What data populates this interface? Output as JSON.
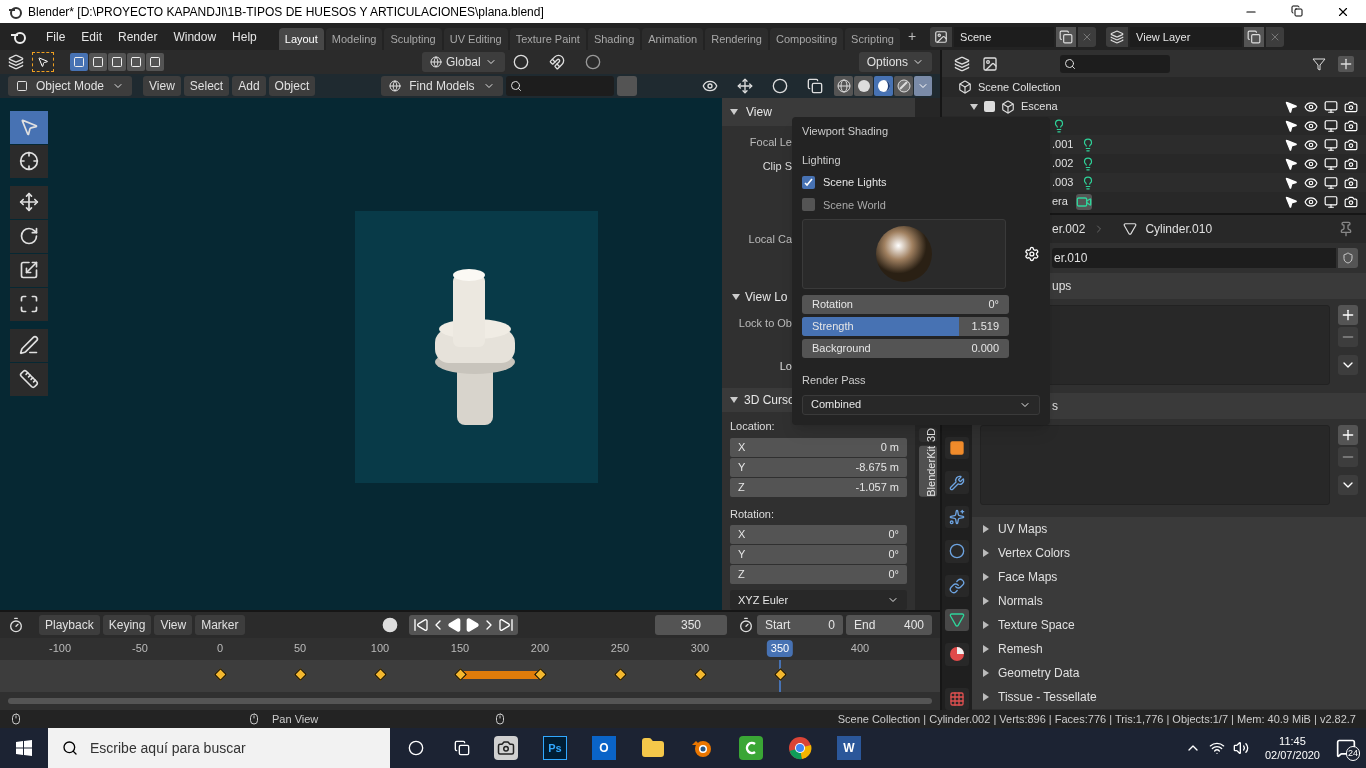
{
  "window": {
    "title": "Blender* [D:\\PROYECTO KAPANDJI\\1B-TIPOS DE HUESOS Y ARTICULACIONES\\plana.blend]"
  },
  "menu": [
    "File",
    "Edit",
    "Render",
    "Window",
    "Help"
  ],
  "workspaces": [
    {
      "label": "Layout",
      "selected": true
    },
    {
      "label": "Modeling",
      "selected": false
    },
    {
      "label": "Sculpting",
      "selected": false
    },
    {
      "label": "UV Editing",
      "selected": false
    },
    {
      "label": "Texture Paint",
      "selected": false
    },
    {
      "label": "Shading",
      "selected": false
    },
    {
      "label": "Animation",
      "selected": false
    },
    {
      "label": "Rendering",
      "selected": false
    },
    {
      "label": "Compositing",
      "selected": false
    },
    {
      "label": "Scripting",
      "selected": false
    }
  ],
  "add_workspace": "+",
  "scene_selector": {
    "value": "Scene"
  },
  "view_layer_selector": {
    "value": "View Layer"
  },
  "viewport": {
    "select_modes": [
      {
        "selected": true
      },
      {
        "selected": false
      },
      {
        "selected": false
      },
      {
        "selected": false
      },
      {
        "selected": false
      }
    ],
    "orientation": "Global",
    "options": "Options",
    "mode": "Object Mode",
    "menus": [
      "View",
      "Select",
      "Add",
      "Object"
    ],
    "find_models": "Find Models",
    "shading_modes": [
      {
        "kind": "wireframe",
        "selected": false
      },
      {
        "kind": "solid",
        "selected": false
      },
      {
        "kind": "material",
        "selected": true
      },
      {
        "kind": "rendered",
        "selected": false
      }
    ],
    "tools": [
      {
        "kind": "select-box",
        "selected": true
      },
      {
        "kind": "cursor",
        "selected": false
      },
      {
        "kind": "move",
        "selected": false
      },
      {
        "kind": "rotate",
        "selected": false
      },
      {
        "kind": "scale",
        "selected": false
      },
      {
        "kind": "transform",
        "selected": false
      },
      {
        "kind": "annotate",
        "selected": false
      },
      {
        "kind": "measure",
        "selected": false
      }
    ]
  },
  "sidebar": {
    "view_panel": {
      "title": "View",
      "expanded": true,
      "labels": [
        "Focal Le",
        "Clip S",
        "Local Ca"
      ]
    },
    "view_lock_panel": {
      "title": "View Lo",
      "expanded": true,
      "labels": [
        "Lock to Ob",
        "Lo"
      ]
    },
    "cursor_panel": {
      "title": "3D Curso",
      "expanded": true,
      "location_label": "Location:",
      "location": [
        {
          "axis": "X",
          "value": "0 m"
        },
        {
          "axis": "Y",
          "value": "-8.675 m"
        },
        {
          "axis": "Z",
          "value": "-1.057 m"
        }
      ],
      "rotation_label": "Rotation:",
      "rotation": [
        {
          "axis": "X",
          "value": "0°"
        },
        {
          "axis": "Y",
          "value": "0°"
        },
        {
          "axis": "Z",
          "value": "0°"
        }
      ],
      "rotation_mode": "XYZ Euler"
    },
    "tabs": [
      {
        "label": "3D",
        "selected": false
      },
      {
        "label": "BlenderKit",
        "selected": true
      }
    ]
  },
  "shading_popover": {
    "title": "Viewport Shading",
    "lighting_label": "Lighting",
    "options": [
      {
        "label": "Scene Lights",
        "checked": true
      },
      {
        "label": "Scene World",
        "checked": false
      }
    ],
    "sliders": [
      {
        "label": "Rotation",
        "value": "0°",
        "level": 0
      },
      {
        "label": "Strength",
        "value": "1.519",
        "level": 0.76
      },
      {
        "label": "Background",
        "value": "0.000",
        "level": 0
      }
    ],
    "render_pass_label": "Render Pass",
    "render_pass": "Combined"
  },
  "outliner": {
    "root": "Scene Collection",
    "collections": [
      {
        "name": "Escena",
        "checked": true,
        "expanded": true,
        "children": [
          {
            "kind": "light"
          },
          {
            "name": ".001",
            "kind": "light"
          },
          {
            "name": ".002",
            "kind": "light"
          },
          {
            "name": ".003",
            "kind": "light"
          },
          {
            "name": "era",
            "kind": "camera"
          }
        ]
      }
    ]
  },
  "properties": {
    "tabs": [
      {
        "kind": "object",
        "selected": false
      },
      {
        "kind": "modifiers",
        "selected": false
      },
      {
        "kind": "particles",
        "selected": false
      },
      {
        "kind": "physics",
        "selected": false
      },
      {
        "kind": "constraints",
        "selected": false
      },
      {
        "kind": "data",
        "selected": true
      },
      {
        "kind": "material",
        "selected": false
      },
      {
        "kind": "texture",
        "selected": false
      }
    ],
    "breadcrumb": [
      "er.002",
      "Cylinder.010"
    ],
    "mesh_name": "er.010",
    "list_panels": [
      {
        "title": "ups"
      },
      {
        "title": "s"
      }
    ],
    "panels": [
      {
        "title": "UV Maps",
        "expanded": false
      },
      {
        "title": "Vertex Colors",
        "expanded": false
      },
      {
        "title": "Face Maps",
        "expanded": false
      },
      {
        "title": "Normals",
        "expanded": false
      },
      {
        "title": "Texture Space",
        "expanded": false
      },
      {
        "title": "Remesh",
        "expanded": false
      },
      {
        "title": "Geometry Data",
        "expanded": false
      },
      {
        "title": "Tissue - Tessellate",
        "expanded": false
      }
    ]
  },
  "timeline": {
    "menus": [
      "Playback",
      "Keying",
      "View",
      "Marker"
    ],
    "current_frame": "350",
    "start_label": "Start",
    "start": "0",
    "end_label": "End",
    "end": "400",
    "ticks": [
      {
        "label": "-100",
        "keyframe": false,
        "hold": false,
        "selected": false
      },
      {
        "label": "-50",
        "keyframe": false,
        "hold": false,
        "selected": false
      },
      {
        "label": "0",
        "keyframe": true,
        "hold": false,
        "selected": false
      },
      {
        "label": "50",
        "keyframe": true,
        "hold": false,
        "selected": false
      },
      {
        "label": "100",
        "keyframe": true,
        "hold": false,
        "selected": false
      },
      {
        "label": "150",
        "keyframe": true,
        "hold": true,
        "selected": false
      },
      {
        "label": "200",
        "keyframe": true,
        "hold": false,
        "selected": false
      },
      {
        "label": "250",
        "keyframe": true,
        "hold": false,
        "selected": false
      },
      {
        "label": "300",
        "keyframe": true,
        "hold": false,
        "selected": false
      },
      {
        "label": "350",
        "keyframe": true,
        "hold": false,
        "selected": true
      },
      {
        "label": "400",
        "keyframe": false,
        "hold": false,
        "selected": false
      }
    ]
  },
  "status_bar": {
    "hint": "Pan View",
    "stats": "Scene Collection | Cylinder.002 | Verts:896 | Faces:776 | Tris:1,776 | Objects:1/7 | Mem: 40.9 MiB | v2.82.7"
  },
  "taskbar": {
    "search_placeholder": "Escribe aquí para buscar",
    "apps": [
      {
        "kind": "recorder"
      },
      {
        "kind": "photoshop",
        "label": "Ps"
      },
      {
        "kind": "outlook",
        "label": "O"
      },
      {
        "kind": "folder"
      },
      {
        "kind": "blender"
      },
      {
        "kind": "camtasia"
      },
      {
        "kind": "chrome"
      },
      {
        "kind": "word",
        "label": "W"
      }
    ],
    "time": "11:45",
    "date": "02/07/2020",
    "notifications": "24"
  }
}
